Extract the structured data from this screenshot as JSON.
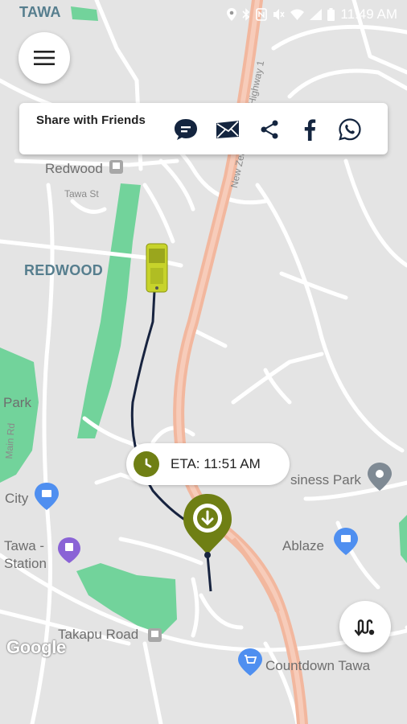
{
  "status_bar": {
    "time": "11:49 AM"
  },
  "menu": {
    "icon": "hamburger-icon"
  },
  "share": {
    "title": "Share with Friends",
    "icons": [
      "message-icon",
      "email-icon",
      "share-icon",
      "facebook-icon",
      "whatsapp-icon"
    ]
  },
  "eta": {
    "label": "ETA: 11:51 AM"
  },
  "map": {
    "labels": {
      "tawa_top": "TAWA",
      "redwood_station": "Redwood",
      "tawa_st": "Tawa St",
      "redwood_area": "REDWOOD",
      "park": "Park",
      "city": "City",
      "tawa_station": "Tawa -\nStation",
      "business_park": "siness Park",
      "ablaze": "Ablaze",
      "takapu_road": "Takapu Road",
      "countdown": "Countdown Tawa",
      "main_rd": "Main Rd",
      "highway": "New Zealand State Highway 1"
    },
    "attribution": "Google",
    "colors": {
      "route": "#17233f",
      "accent": "#6f7f14",
      "bus": "#c7d32b",
      "motorway": "#f0b79c",
      "park": "#6fcf97"
    }
  },
  "route_button": {
    "icon": "route-icon"
  }
}
